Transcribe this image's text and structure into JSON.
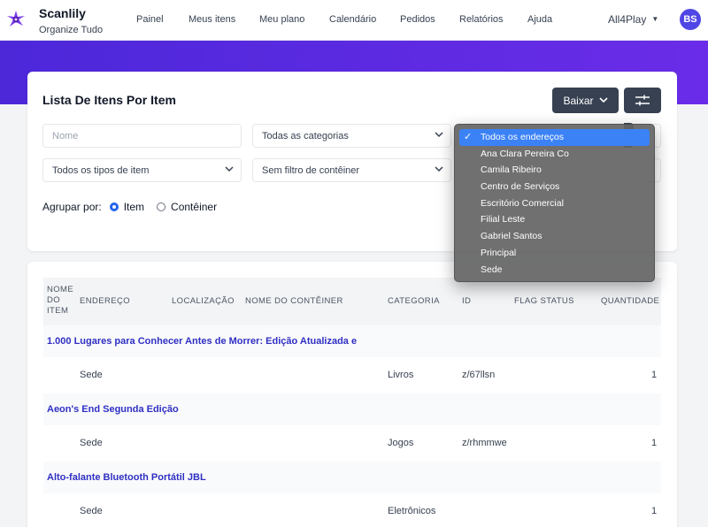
{
  "app": {
    "name": "Scanlily",
    "tagline": "Organize Tudo"
  },
  "nav": {
    "links": [
      "Painel",
      "Meus itens",
      "Meu plano",
      "Calendário",
      "Pedidos",
      "Relatórios",
      "Ajuda"
    ],
    "account": "All4Play",
    "avatar": "BS"
  },
  "colors": {
    "brand": "#5a2be0",
    "dark_button": "#374151",
    "link": "#2f2fc4",
    "select_highlight": "#3b82f6"
  },
  "filters": {
    "title": "Lista De Itens Por Item",
    "download_label": "Baixar",
    "name_placeholder": "Nome",
    "category": "Todas as categorias",
    "item_type": "Todos os tipos de item",
    "container": "Sem filtro de contêiner",
    "group_by_label": "Agrupar por:",
    "group_options": [
      "Item",
      "Contêiner"
    ],
    "group_selected": "Item"
  },
  "address_dropdown": {
    "selected": "Todos os endereços",
    "options": [
      "Todos os endereços",
      "Ana Clara Pereira Co",
      "Camila Ribeiro",
      "Centro de Serviços",
      "Escritório Comercial",
      "Filial Leste",
      "Gabriel Santos",
      "Principal",
      "Sede"
    ]
  },
  "table": {
    "headers": {
      "name": [
        "NOME",
        "DO",
        "ITEM"
      ],
      "address": "ENDEREÇO",
      "location": "LOCALIZAÇÃO",
      "container_name": "NOME DO CONTÊINER",
      "category": "CATEGORIA",
      "id": "ID",
      "flag_status": "FLAG STATUS",
      "quantity": "QUANTIDADE"
    },
    "groups": [
      {
        "title": "1.000 Lugares para Conhecer Antes de Morrer: Edição Atualizada e",
        "address": "Sede",
        "category": "Livros",
        "id": "z/67llsn",
        "quantity": "1"
      },
      {
        "title": "Aeon's End Segunda Edição",
        "address": "Sede",
        "category": "Jogos",
        "id": "z/rhmmwe",
        "quantity": "1"
      },
      {
        "title": "Alto-falante Bluetooth Portátil JBL",
        "address": "Sede",
        "category": "Eletrônicos",
        "id": "",
        "quantity": "1"
      }
    ]
  }
}
